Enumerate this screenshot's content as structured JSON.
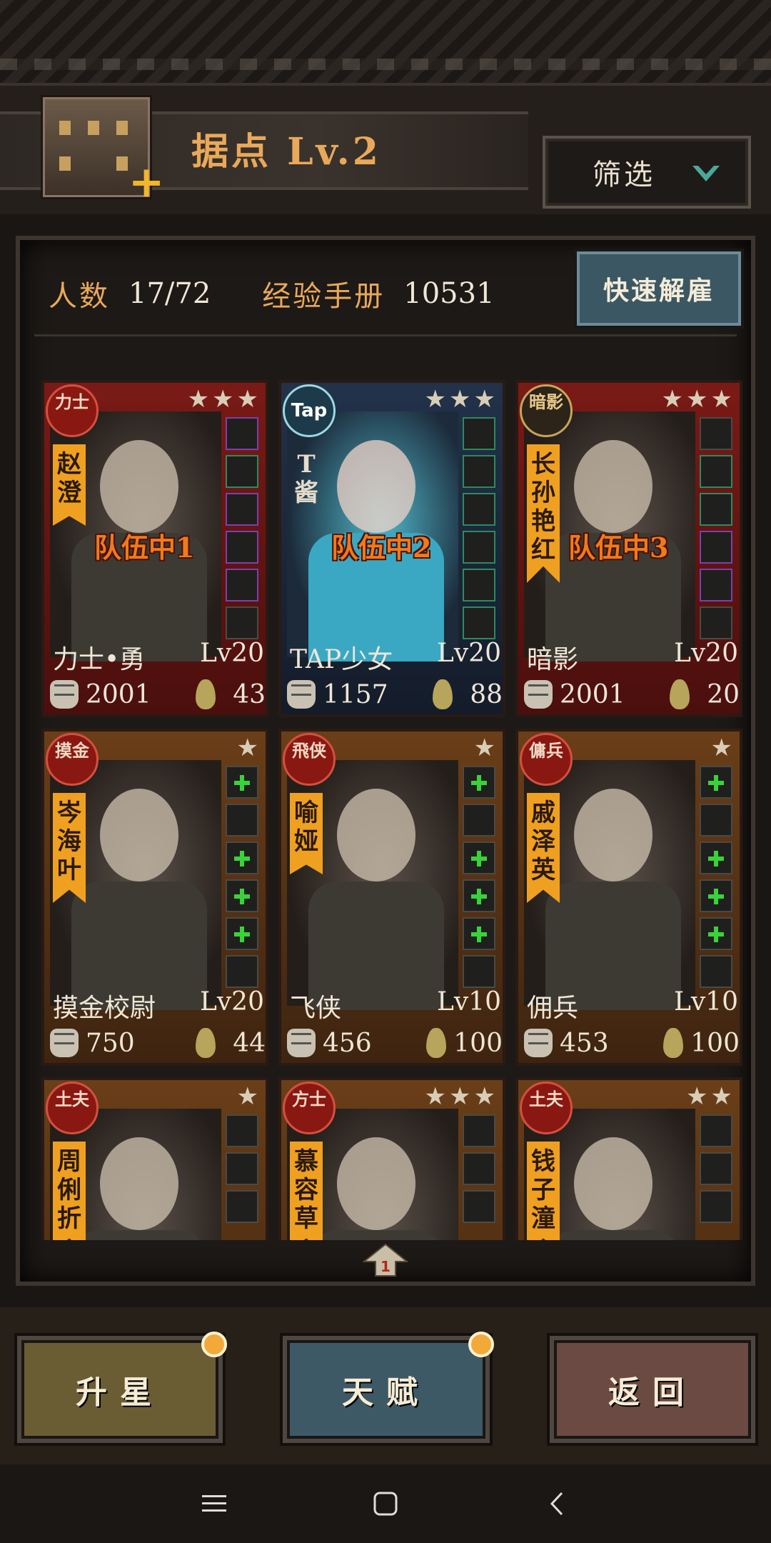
{
  "header": {
    "title": "据点  Lv.2",
    "filter_label": "筛选"
  },
  "stats": {
    "count_label": "人数",
    "count_value": "17/72",
    "exp_label": "经验手册",
    "exp_value": "10531",
    "quick_dismiss": "快速解雇"
  },
  "cards": [
    {
      "theme": "red",
      "badge": "力士",
      "badge_style": "red",
      "name": "赵\n澄",
      "stars": 3,
      "team": "队伍中1",
      "class": "力士•勇",
      "level": "Lv20",
      "power": "2001",
      "exp": "43",
      "slots": [
        "rare",
        "uncommon",
        "rare",
        "rare",
        "rare",
        "normal"
      ]
    },
    {
      "theme": "blue",
      "badge": "Tap",
      "badge_style": "tap",
      "name": "T\n酱",
      "stars": 3,
      "team": "队伍中2",
      "class": "TAP少女",
      "level": "Lv20",
      "power": "1157",
      "exp": "88",
      "slots": [
        "uncommon",
        "uncommon",
        "uncommon",
        "uncommon",
        "uncommon",
        "uncommon"
      ]
    },
    {
      "theme": "red",
      "badge": "暗影",
      "badge_style": "dark",
      "name": "长\n孙\n艳\n红",
      "stars": 3,
      "team": "队伍中3",
      "class": "暗影",
      "level": "Lv20",
      "power": "2001",
      "exp": "20",
      "slots": [
        "normal",
        "uncommon",
        "uncommon",
        "rare",
        "rare",
        "normal"
      ]
    },
    {
      "theme": "brown",
      "badge": "摸金",
      "badge_style": "red",
      "name": "岑\n海\n叶",
      "stars": 1,
      "team": "",
      "class": "摸金校尉",
      "level": "Lv20",
      "power": "750",
      "exp": "44",
      "slots": [
        "plus",
        "normal",
        "plus",
        "plus",
        "plus",
        "normal"
      ]
    },
    {
      "theme": "brown",
      "badge": "飛侠",
      "badge_style": "red",
      "name": "喻\n娅",
      "stars": 1,
      "team": "",
      "class": "飞侠",
      "level": "Lv10",
      "power": "456",
      "exp": "100",
      "slots": [
        "plus",
        "normal",
        "plus",
        "plus",
        "plus",
        "normal"
      ]
    },
    {
      "theme": "brown",
      "badge": "傭兵",
      "badge_style": "red",
      "name": "戚\n泽\n英",
      "stars": 1,
      "team": "",
      "class": "佣兵",
      "level": "Lv10",
      "power": "453",
      "exp": "100",
      "slots": [
        "plus",
        "normal",
        "plus",
        "plus",
        "plus",
        "normal"
      ]
    },
    {
      "theme": "brown",
      "badge": "土夫",
      "badge_style": "red",
      "name": "周\n俐\n折",
      "stars": 1,
      "team": "",
      "class": "",
      "level": "",
      "power": "",
      "exp": "",
      "slots": [
        "normal",
        "normal",
        "normal"
      ]
    },
    {
      "theme": "brown",
      "badge": "方士",
      "badge_style": "red",
      "name": "慕\n容\n草",
      "stars": 3,
      "team": "",
      "class": "",
      "level": "",
      "power": "",
      "exp": "",
      "slots": [
        "normal",
        "normal",
        "normal"
      ]
    },
    {
      "theme": "brown",
      "badge": "土夫",
      "badge_style": "red",
      "name": "钱\n子\n潼",
      "stars": 2,
      "team": "",
      "class": "",
      "level": "",
      "power": "",
      "exp": "",
      "slots": [
        "normal",
        "normal",
        "normal"
      ]
    }
  ],
  "page_indicator": "1",
  "buttons": {
    "star_up": "升星",
    "talent": "天赋",
    "back": "返回"
  },
  "colors": {
    "accent_orange": "#e9a85a",
    "team_tag": "#f07a1c",
    "card_red": "#7a1a16",
    "card_blue": "#22324a",
    "card_brown": "#6a3e18"
  }
}
